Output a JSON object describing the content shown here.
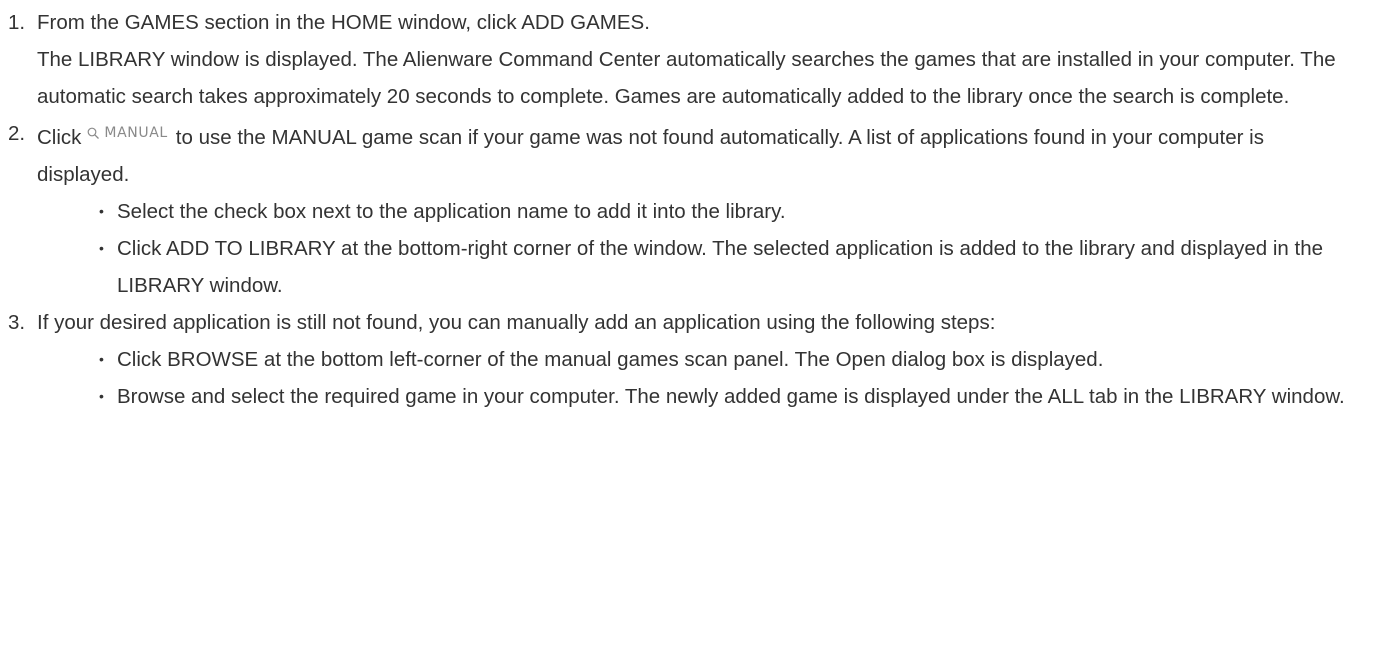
{
  "steps": [
    {
      "number": "1.",
      "line1": "From the GAMES section in the HOME window, click ADD GAMES.",
      "line2": "The LIBRARY window is displayed. The Alienware Command Center automatically searches the games that are installed in your computer. The automatic search takes approximately 20 seconds to complete. Games are automatically added to the library once the search is complete."
    },
    {
      "number": "2.",
      "text_before": "Click",
      "button_label": "MANUAL",
      "button_icon": "search-icon",
      "text_after": "to use the MANUAL game scan if your game was not found automatically. A list of applications found in your computer is displayed.",
      "bullets": [
        "Select the check box next to the application name to add it into the library.",
        "Click ADD TO LIBRARY at the bottom-right corner of the window.  The selected application is added to the library and displayed in the LIBRARY window."
      ]
    },
    {
      "number": "3.",
      "text": "If your desired application is still not found, you can manually add an application using the following steps:",
      "bullets": [
        "Click BROWSE at the bottom left-corner of the manual games scan panel. The Open dialog box is displayed.",
        "Browse and select the required game in your computer. The newly added game is displayed under the ALL tab in the LIBRARY window."
      ]
    }
  ],
  "bullet_symbol": "•"
}
